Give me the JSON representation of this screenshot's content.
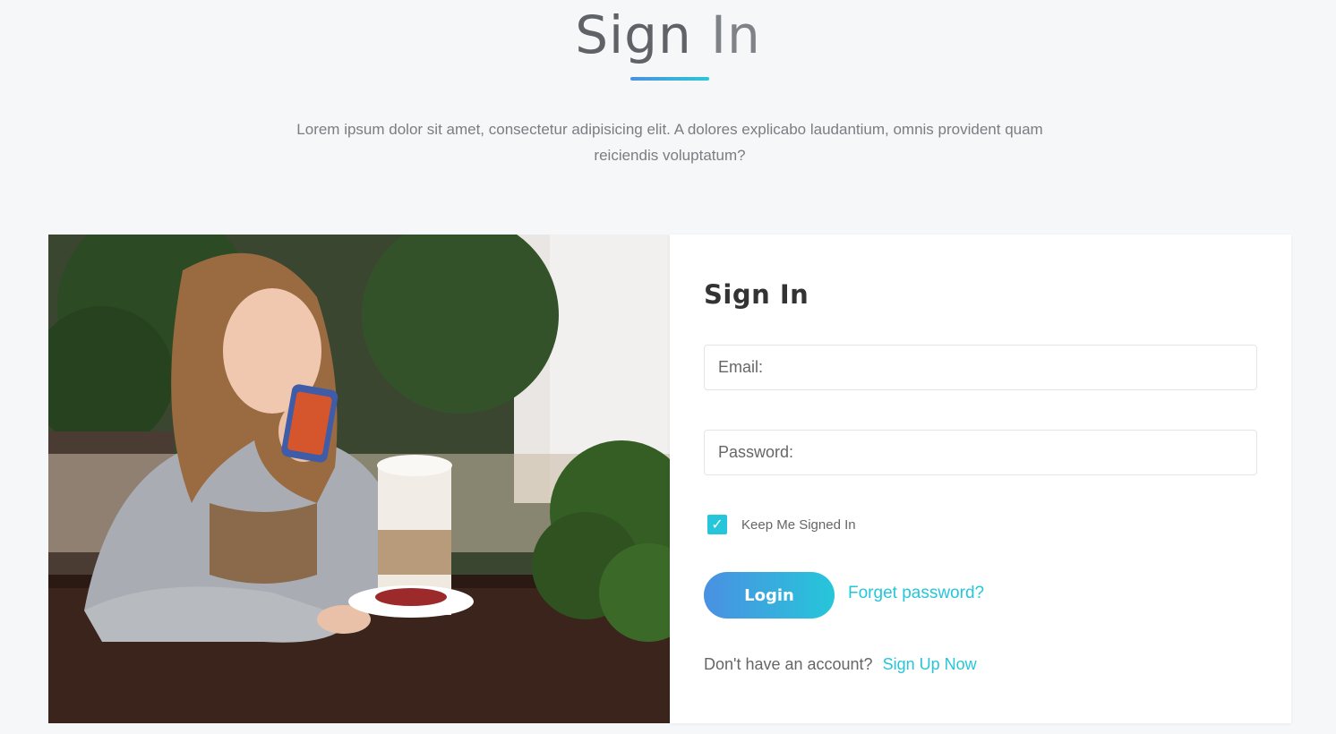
{
  "header": {
    "title_word1": "Sign",
    "title_word2": "In",
    "intro": "Lorem ipsum dolor sit amet, consectetur adipisicing elit. A dolores explicabo laudantium, omnis provident quam reiciendis voluptatum?"
  },
  "form": {
    "title": "Sign In",
    "email_placeholder": "Email:",
    "password_placeholder": "Password:",
    "remember_label": "Keep Me Signed In",
    "remember_checked": true,
    "login_label": "Login",
    "forgot_label": "Forget password?",
    "signup_prompt": "Don't have an account?",
    "signup_link": "Sign Up Now"
  },
  "colors": {
    "accent": "#26c6da",
    "accent_blue": "#4a90e2",
    "background": "#f6f7f9"
  },
  "icons": {
    "checkbox": "check-icon"
  }
}
